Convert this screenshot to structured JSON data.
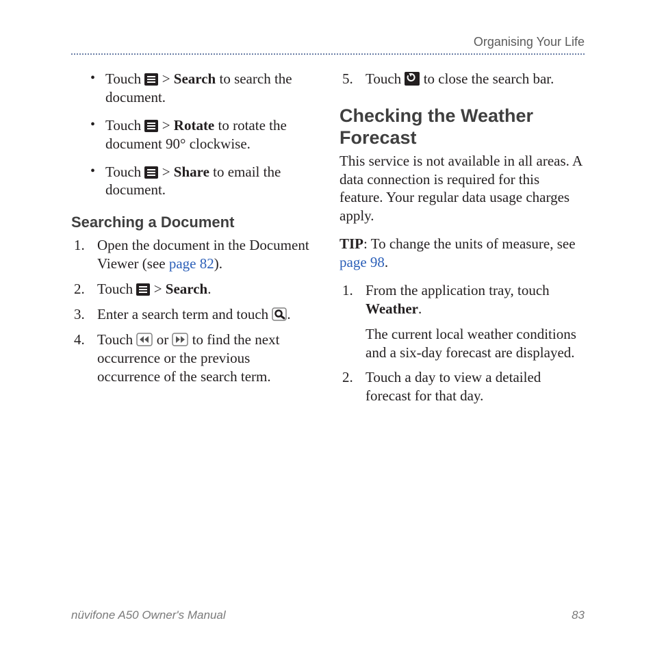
{
  "runningHead": "Organising Your Life",
  "bullets": [
    {
      "pre": "Touch ",
      "post1": " > ",
      "bold": "Search",
      "post2": " to search the document."
    },
    {
      "pre": "Touch ",
      "post1": " > ",
      "bold": "Rotate",
      "post2": " to rotate the document 90° clockwise."
    },
    {
      "pre": "Touch ",
      "post1": " > ",
      "bold": "Share",
      "post2": " to email the document."
    }
  ],
  "h3_search": "Searching a Document",
  "steps_search": {
    "s1a": "Open the document in the Document Viewer (see ",
    "s1link": "page 82",
    "s1b": ").",
    "s2a": "Touch ",
    "s2b": " > ",
    "s2bold": "Search",
    "s2c": ".",
    "s3a": "Enter a search term and touch ",
    "s3b": ".",
    "s4a": "Touch ",
    "s4or": " or ",
    "s4b": " to find the next occurrence or the previous occurrence of the search term.",
    "s5a": "Touch ",
    "s5b": " to close the search bar."
  },
  "h2_weather": "Checking the Weather Forecast",
  "weather_intro": "This service is not available in all areas. A data connection is required for this feature. Your regular data usage charges apply.",
  "tip_label": "TIP",
  "tip_a": ": To change the units of measure, see ",
  "tip_link": "page 98",
  "tip_b": ".",
  "steps_weather": {
    "w1a": "From the application tray, touch ",
    "w1bold": "Weather",
    "w1b": ".",
    "w1sub": "The current local weather conditions and a six-day forecast are displayed.",
    "w2": "Touch a day to view a detailed forecast for that day."
  },
  "footer_left": "nüvifone A50 Owner's Manual",
  "footer_right": "83"
}
